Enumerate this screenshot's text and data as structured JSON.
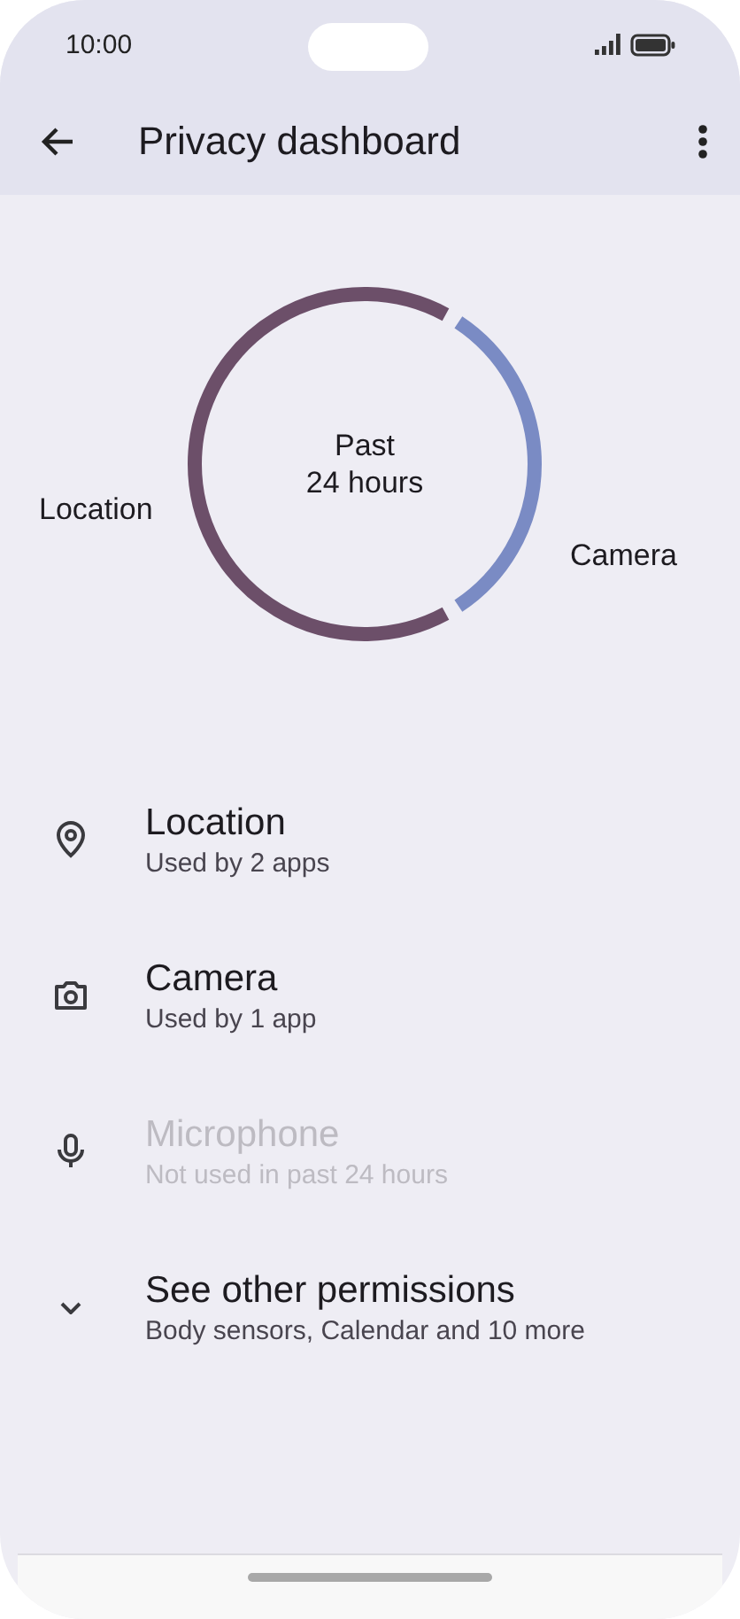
{
  "status_bar": {
    "time": "10:00"
  },
  "app_bar": {
    "title": "Privacy dashboard"
  },
  "usage_ring": {
    "center_lines": [
      "Past",
      "24 hours"
    ],
    "segments": [
      {
        "label": "Location",
        "color": "#6c4f69"
      },
      {
        "label": "Camera",
        "color": "#7a8bc4"
      }
    ]
  },
  "permissions": [
    {
      "kind": "location",
      "title": "Location",
      "subtitle": "Used by 2 apps",
      "disabled": false
    },
    {
      "kind": "camera",
      "title": "Camera",
      "subtitle": "Used by 1 app",
      "disabled": false
    },
    {
      "kind": "microphone",
      "title": "Microphone",
      "subtitle": "Not used in past 24 hours",
      "disabled": true
    },
    {
      "kind": "expand",
      "title": "See other permissions",
      "subtitle": "Body sensors, Calendar and 10 more",
      "disabled": false
    }
  ]
}
